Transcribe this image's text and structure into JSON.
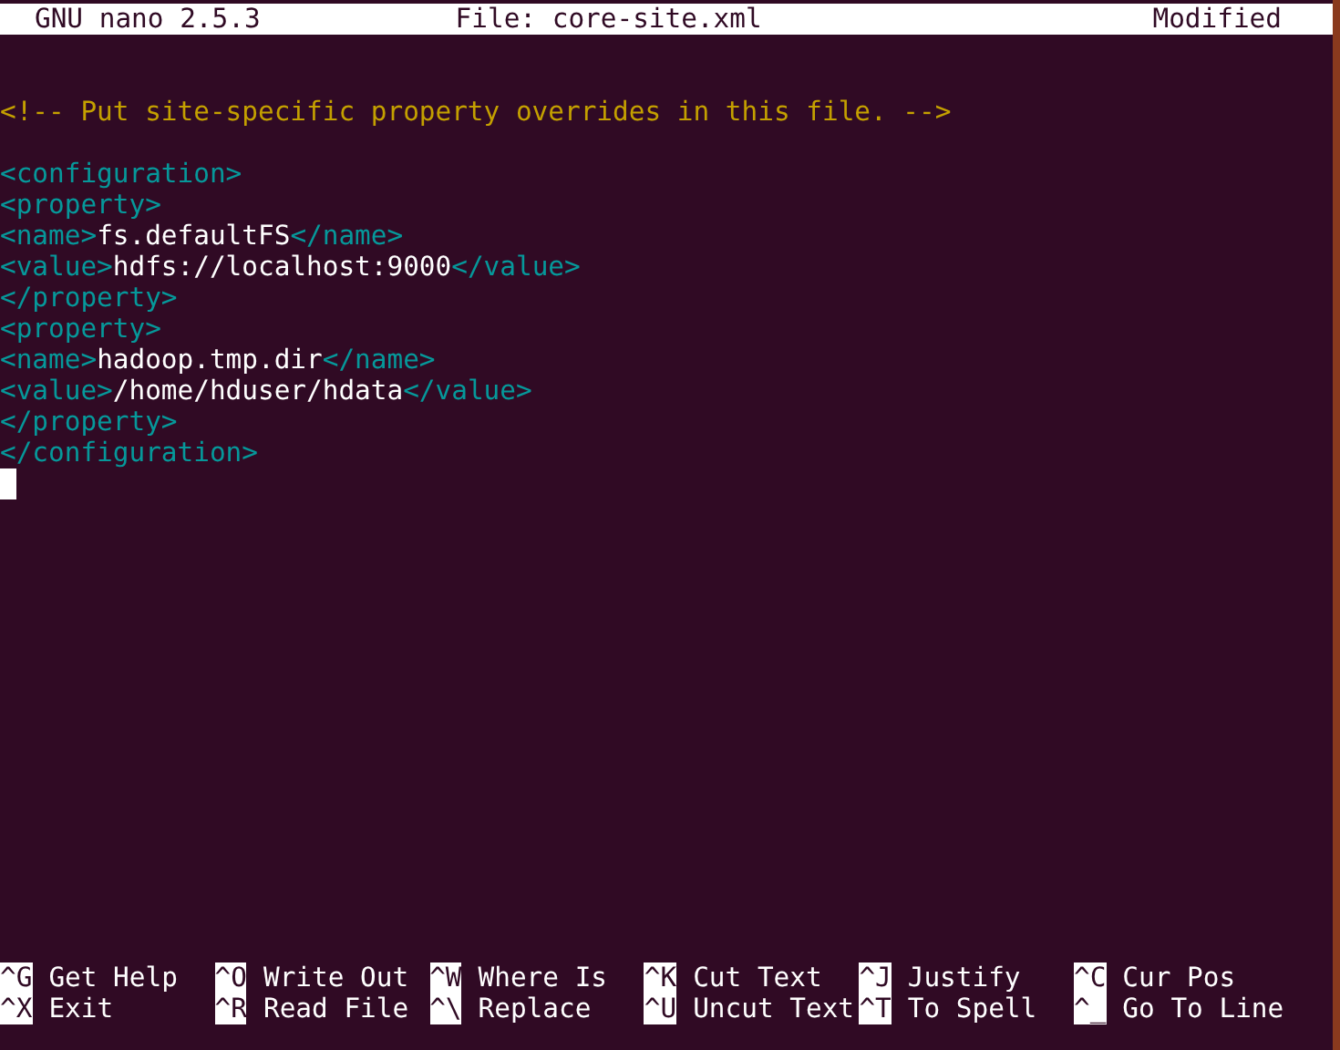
{
  "title_bar": {
    "version": "GNU nano 2.5.3",
    "file": "File: core-site.xml",
    "status": "Modified"
  },
  "lines": [
    {
      "kind": "code"
    },
    {
      "kind": "code",
      "segments": [
        {
          "kind": "comment",
          "text": "<!-- Put site-specific property overrides in this file. -->"
        }
      ]
    },
    {
      "kind": "code"
    },
    {
      "kind": "code",
      "segments": [
        {
          "kind": "tag",
          "text": "<configuration>"
        }
      ]
    },
    {
      "kind": "code",
      "segments": [
        {
          "kind": "tag",
          "text": "<property>"
        }
      ]
    },
    {
      "kind": "code",
      "segments": [
        {
          "kind": "tag",
          "text": "<name>"
        },
        {
          "kind": "text",
          "text": "fs.defaultFS"
        },
        {
          "kind": "tag",
          "text": "</name>"
        }
      ]
    },
    {
      "kind": "code",
      "segments": [
        {
          "kind": "tag",
          "text": "<value>"
        },
        {
          "kind": "text",
          "text": "hdfs://localhost:9000"
        },
        {
          "kind": "tag",
          "text": "</value>"
        }
      ]
    },
    {
      "kind": "code",
      "segments": [
        {
          "kind": "tag",
          "text": "</property>"
        }
      ]
    },
    {
      "kind": "code",
      "segments": [
        {
          "kind": "tag",
          "text": "<property>"
        }
      ]
    },
    {
      "kind": "code",
      "segments": [
        {
          "kind": "tag",
          "text": "<name>"
        },
        {
          "kind": "text",
          "text": "hadoop.tmp.dir"
        },
        {
          "kind": "tag",
          "text": "</name>"
        }
      ]
    },
    {
      "kind": "code",
      "segments": [
        {
          "kind": "tag",
          "text": "<value>"
        },
        {
          "kind": "text",
          "text": "/home/hduser/hdata"
        },
        {
          "kind": "tag",
          "text": "</value>"
        }
      ]
    },
    {
      "kind": "code",
      "segments": [
        {
          "kind": "tag",
          "text": "</property>"
        }
      ]
    },
    {
      "kind": "code",
      "segments": [
        {
          "kind": "tag",
          "text": "</configuration>"
        }
      ]
    },
    {
      "kind": "cursor"
    }
  ],
  "shortcuts": [
    {
      "key": "^G",
      "label": "Get Help"
    },
    {
      "key": "^O",
      "label": "Write Out"
    },
    {
      "key": "^W",
      "label": "Where Is"
    },
    {
      "key": "^K",
      "label": "Cut Text"
    },
    {
      "key": "^J",
      "label": "Justify"
    },
    {
      "key": "^C",
      "label": "Cur Pos"
    },
    {
      "key": "^X",
      "label": "Exit"
    },
    {
      "key": "^R",
      "label": "Read File"
    },
    {
      "key": "^\\",
      "label": "Replace"
    },
    {
      "key": "^U",
      "label": "Uncut Text"
    },
    {
      "key": "^T",
      "label": "To Spell"
    },
    {
      "key": "^_",
      "label": "Go To Line"
    }
  ]
}
